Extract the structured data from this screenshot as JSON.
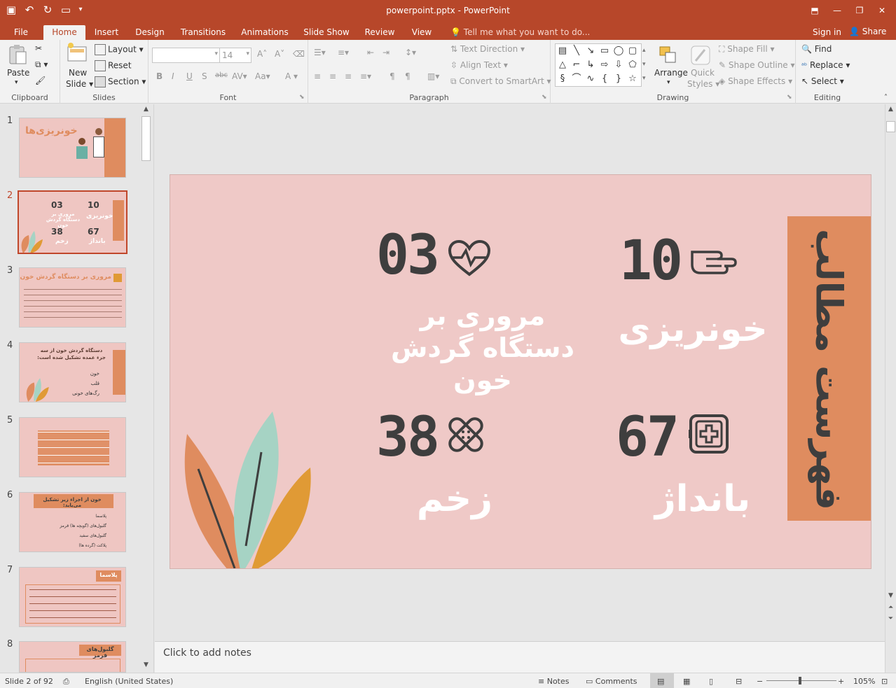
{
  "window": {
    "title": "powerpoint.pptx - PowerPoint"
  },
  "tabs": [
    "File",
    "Home",
    "Insert",
    "Design",
    "Transitions",
    "Animations",
    "Slide Show",
    "Review",
    "View"
  ],
  "tell_me": "Tell me what you want to do...",
  "account": {
    "signin": "Sign in",
    "share": "Share"
  },
  "ribbon": {
    "clipboard": {
      "label": "Clipboard",
      "paste": "Paste"
    },
    "slides": {
      "label": "Slides",
      "new_slide": "New",
      "new_slide2": "Slide",
      "layout": "Layout",
      "reset": "Reset",
      "section": "Section"
    },
    "font": {
      "label": "Font",
      "size": "14"
    },
    "paragraph": {
      "label": "Paragraph",
      "text_direction": "Text Direction",
      "align_text": "Align Text",
      "smartart": "Convert to SmartArt"
    },
    "drawing": {
      "label": "Drawing",
      "arrange": "Arrange",
      "quick_styles": "Quick",
      "quick_styles2": "Styles",
      "shape_fill": "Shape Fill",
      "shape_outline": "Shape Outline",
      "shape_effects": "Shape Effects"
    },
    "editing": {
      "label": "Editing",
      "find": "Find",
      "replace": "Replace",
      "select": "Select"
    }
  },
  "thumbnails": {
    "numbers": [
      "1",
      "2",
      "3",
      "4",
      "5",
      "6",
      "7",
      "8"
    ],
    "t1_title": "خونریزی‌ها",
    "t3_title": "مروری بر دستگاه گردش خون",
    "t4_title": "دستگاه گردش خون از سه جزء عمده تشکیل شده است:",
    "t4_items": [
      "خون",
      "قلب",
      "رگ‌های خونی"
    ],
    "t6_title": "خون از اجزاء زیر تشکیل می‌یابد:",
    "t6_items": [
      "پلاسما",
      "گلبول‌های (گویچه ها) قرمز",
      "گلبول‌های سفید",
      "پلاکت (گرده ها)"
    ],
    "t7_title": "پلاسما",
    "t8_title": "گلبول‌های قرمز"
  },
  "slide": {
    "title": "فهرست مطالب",
    "items": [
      {
        "number": "03",
        "label": "مروری بر دستگاه گردش خون",
        "icon": "heartbeat-icon"
      },
      {
        "number": "10",
        "label": "خونریزی",
        "icon": "pointing-hand-icon"
      },
      {
        "number": "38",
        "label": "زخم",
        "icon": "bandage-icon"
      },
      {
        "number": "67",
        "label": "بانداژ",
        "icon": "first-aid-kit-icon"
      }
    ],
    "colors": {
      "background": "#efc9c7",
      "title_box": "#df8c5f",
      "number": "#3e3e3e",
      "label": "#ffffff",
      "leaf_mint": "#a6d3c4",
      "leaf_orange": "#df8c5f",
      "leaf_gold": "#e09a35"
    }
  },
  "notes_placeholder": "Click to add notes",
  "status": {
    "slide": "Slide 2 of 92",
    "language": "English (United States)",
    "notes": "Notes",
    "comments": "Comments",
    "zoom": "105%"
  }
}
